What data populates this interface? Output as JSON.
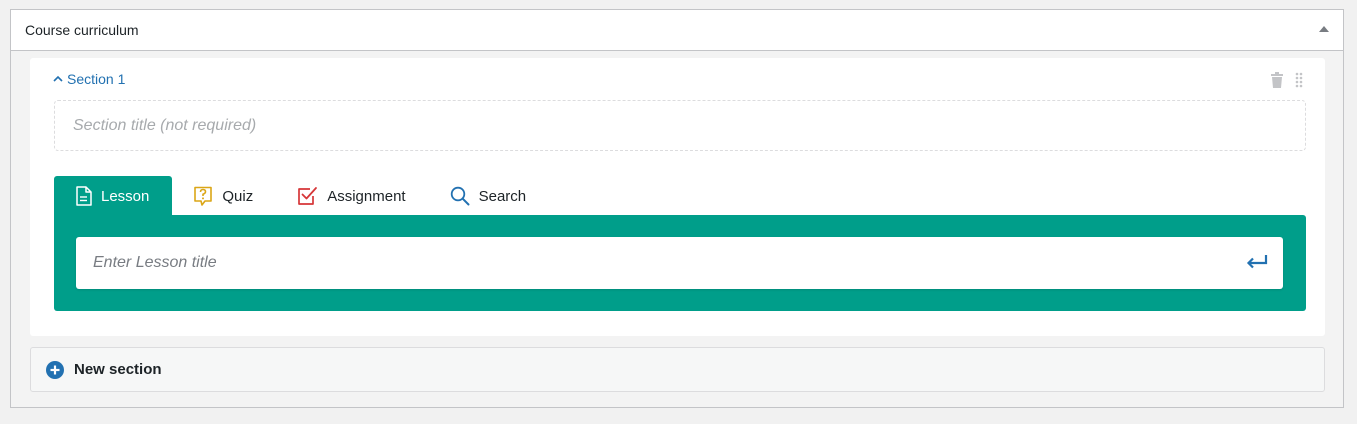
{
  "metabox": {
    "title": "Course curriculum"
  },
  "section": {
    "toggle_label": "Section 1",
    "title_placeholder": "Section title (not required)"
  },
  "tabs": [
    {
      "label": "Lesson",
      "icon": "document-icon",
      "active": true
    },
    {
      "label": "Quiz",
      "icon": "question-bubble-icon",
      "active": false
    },
    {
      "label": "Assignment",
      "icon": "checkbox-icon",
      "active": false
    },
    {
      "label": "Search",
      "icon": "search-icon",
      "active": false
    }
  ],
  "lesson": {
    "placeholder": "Enter Lesson title"
  },
  "new_section": {
    "label": "New section"
  },
  "colors": {
    "accent_teal": "#009e8a",
    "link_blue": "#2271b1",
    "quiz_orange": "#dba617",
    "assignment_red": "#d63638",
    "search_blue": "#2271b1",
    "plus_blue": "#2271b1"
  }
}
